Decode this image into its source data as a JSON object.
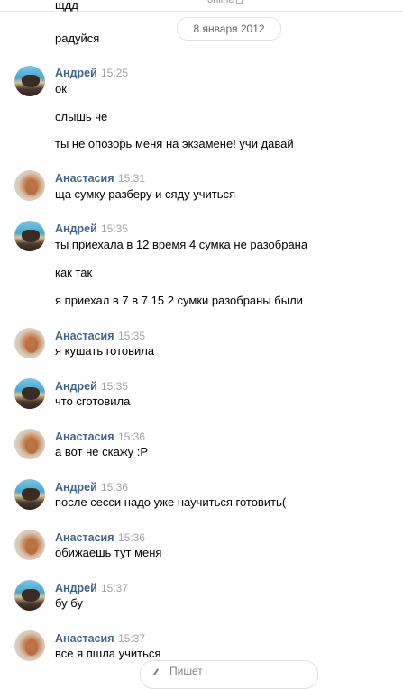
{
  "status": {
    "online_text": "online"
  },
  "date_pill": "8 января 2012",
  "top_partial_text": "щдд",
  "messages": [
    {
      "text": "радуйся"
    },
    {
      "author": "Андрей",
      "time": "15:25",
      "lines": [
        "ок",
        "слышь че",
        "ты не опозорь меня на экзамене! учи давай"
      ]
    },
    {
      "author": "Анастасия",
      "time": "15:31",
      "lines": [
        "ща сумку разберу и сяду учиться"
      ]
    },
    {
      "author": "Андрей",
      "time": "15:35",
      "lines": [
        "ты приехала в 12 время 4 сумка не разобрана",
        "как так",
        "я приехал в 7 в 7 15 2 сумки разобраны были"
      ]
    },
    {
      "author": "Анастасия",
      "time": "15:35",
      "lines": [
        "я кушать готовила"
      ]
    },
    {
      "author": "Андрей",
      "time": "15:35",
      "lines": [
        "что сготовила"
      ]
    },
    {
      "author": "Анастасия",
      "time": "15:36",
      "lines": [
        "а вот не скажу :Р"
      ]
    },
    {
      "author": "Андрей",
      "time": "15:36",
      "lines": [
        "после сесси надо уже научиться готовить("
      ]
    },
    {
      "author": "Анастасия",
      "time": "15:36",
      "lines": [
        "обижаешь тут меня"
      ]
    },
    {
      "author": "Андрей",
      "time": "15:37",
      "lines": [
        "бу бу"
      ]
    },
    {
      "author": "Анастасия",
      "time": "15:37",
      "lines": [
        "все я пшла учиться"
      ]
    }
  ],
  "bottom_input_label": "Пишет"
}
